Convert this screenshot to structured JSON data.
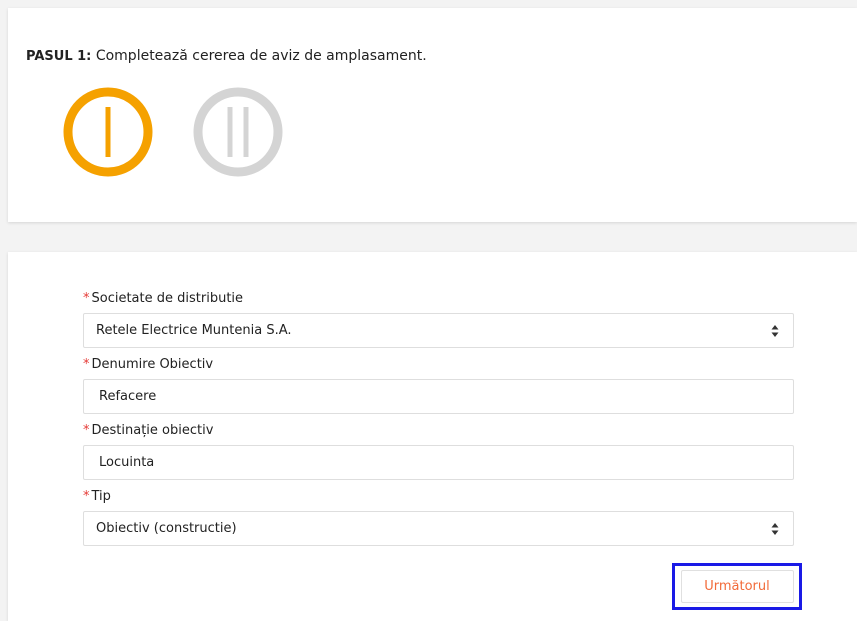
{
  "step": {
    "prefix": "PASUL 1:",
    "text": "Completează cererea de aviz de amplasament.",
    "indicators": [
      {
        "label": "I",
        "state": "active",
        "color": "#f5a100"
      },
      {
        "label": "II",
        "state": "inactive",
        "color": "#d4d4d4"
      }
    ]
  },
  "form": {
    "required_mark": "*",
    "fields": [
      {
        "label": "Societate de distributie",
        "value": "Retele Electrice Muntenia S.A.",
        "kind": "select"
      },
      {
        "label": "Denumire Obiectiv",
        "value": "Refacere",
        "kind": "input"
      },
      {
        "label": "Destinație obiectiv",
        "value": "Locuinta",
        "kind": "input"
      },
      {
        "label": "Tip",
        "value": "Obiectiv (constructie)",
        "kind": "select"
      }
    ],
    "next_label": "Următorul"
  },
  "colors": {
    "accent": "#f5a100",
    "inactive": "#d4d4d4",
    "required": "#e53935",
    "button_text": "#f26b3a",
    "focus_outline": "#1a1ae6"
  }
}
